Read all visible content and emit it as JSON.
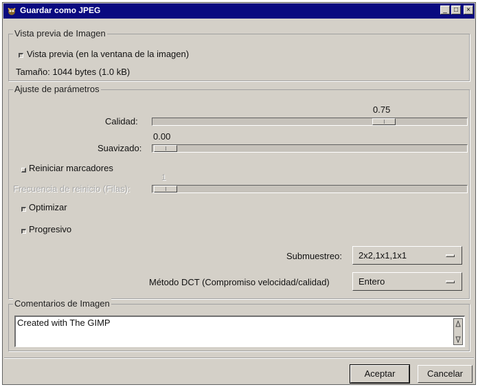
{
  "window": {
    "title": "Guardar como JPEG",
    "controls": {
      "minimize": "_",
      "maximize": "□",
      "close": "×"
    }
  },
  "preview_group": {
    "legend": "Vista previa de Imagen",
    "preview_checkbox": {
      "label": "Vista previa (en la ventana de la imagen)",
      "checked": true
    },
    "size_text": "Tamaño: 1044 bytes (1.0 kB)"
  },
  "params_group": {
    "legend": "Ajuste de parámetros",
    "quality": {
      "label": "Calidad:",
      "value_text": "0.75",
      "value": 0.75,
      "min": 0,
      "max": 1
    },
    "smoothing": {
      "label": "Suavizado:",
      "value_text": "0.00",
      "value": 0.0,
      "min": 0,
      "max": 1
    },
    "restart_markers": {
      "label": "Reiniciar marcadores",
      "checked": false
    },
    "restart_frequency": {
      "label": "Frecuencia de reinicio (Filas):",
      "value_text": "1",
      "value": 1,
      "min": 1,
      "max": 64,
      "disabled": true
    },
    "optimize": {
      "label": "Optimizar",
      "checked": true
    },
    "progressive": {
      "label": "Progresivo",
      "checked": true
    },
    "subsampling": {
      "label": "Submuestreo:",
      "selected": "2x2,1x1,1x1"
    },
    "dct_method": {
      "label": "Método DCT (Compromiso velocidad/calidad)",
      "selected": "Entero"
    }
  },
  "comments_group": {
    "legend": "Comentarios de Imagen",
    "text": "Created with The GIMP"
  },
  "buttons": {
    "ok": "Aceptar",
    "cancel": "Cancelar"
  },
  "colors": {
    "titlebar": "#0a0a80",
    "window_bg": "#d4d0c8"
  },
  "icons": {
    "app": "gimp-icon",
    "scroll_up": "scroll-up-icon",
    "scroll_down": "scroll-down-icon"
  }
}
